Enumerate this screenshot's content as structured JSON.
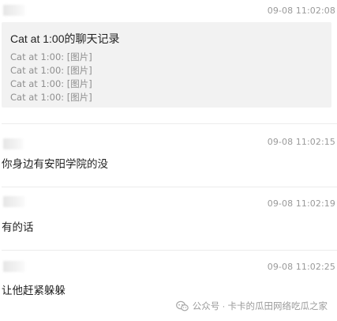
{
  "messages": [
    {
      "time": "09-08 11:02:08",
      "type": "chat-record",
      "record": {
        "title": "Cat at 1:00的聊天记录",
        "lines": [
          "Cat at 1:00: [图片]",
          "Cat at 1:00: [图片]",
          "Cat at 1:00: [图片]",
          "Cat at 1:00: [图片]"
        ]
      }
    },
    {
      "time": "09-08 11:02:15",
      "type": "text",
      "text": "你身边有安阳学院的没"
    },
    {
      "time": "09-08 11:02:19",
      "type": "text",
      "text": "有的话"
    },
    {
      "time": "09-08 11:02:25",
      "type": "text",
      "text": "让他赶紧躲躲"
    }
  ],
  "watermark": {
    "text": "公众号 · 卡卡的瓜田网络吃瓜之家",
    "icon": "wechat-official-account-icon"
  }
}
